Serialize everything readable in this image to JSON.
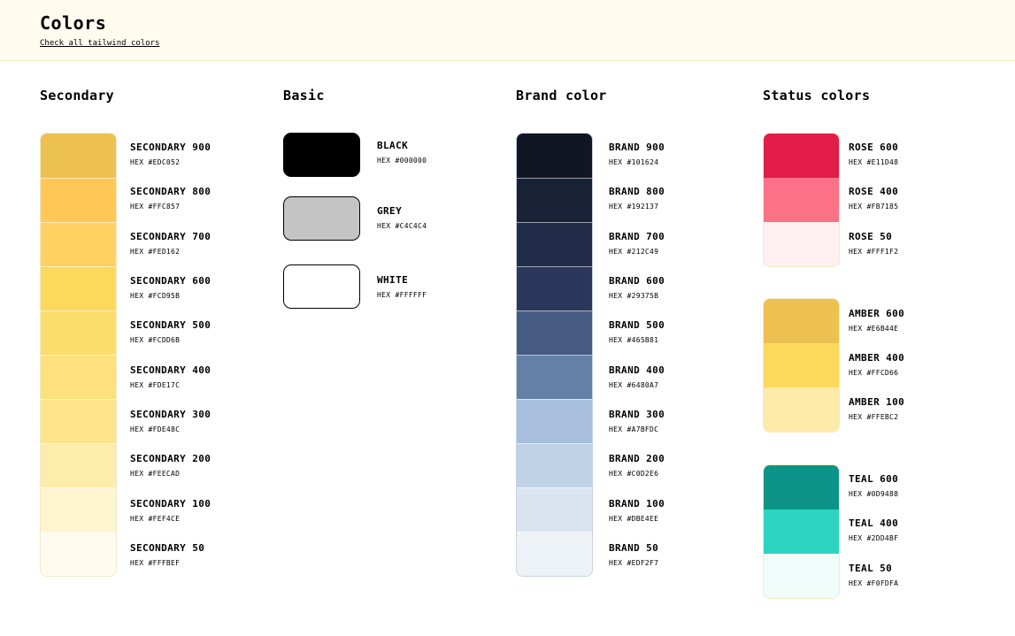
{
  "header": {
    "title": "Colors",
    "link_label": "Check all tailwind colors"
  },
  "secondary": {
    "title": "Secondary",
    "swatches": [
      {
        "name": "SECONDARY 900",
        "hex_label": "HEX #EDC052",
        "color": "#EDC052"
      },
      {
        "name": "SECONDARY 800",
        "hex_label": "HEX #FFC857",
        "color": "#FFC857"
      },
      {
        "name": "SECONDARY 700",
        "hex_label": "HEX #FED162",
        "color": "#FED162"
      },
      {
        "name": "SECONDARY 600",
        "hex_label": "HEX #FCD95B",
        "color": "#FCD95B"
      },
      {
        "name": "SECONDARY 500",
        "hex_label": "HEX #FCDD6B",
        "color": "#FCDD6B"
      },
      {
        "name": "SECONDARY 400",
        "hex_label": "HEX #FDE17C",
        "color": "#FDE17C"
      },
      {
        "name": "SECONDARY 300",
        "hex_label": "HEX #FDE48C",
        "color": "#FDE48C"
      },
      {
        "name": "SECONDARY 200",
        "hex_label": "HEX #FEECAD",
        "color": "#FEECAD"
      },
      {
        "name": "SECONDARY 100",
        "hex_label": "HEX #FEF4CE",
        "color": "#FEF4CE"
      },
      {
        "name": "SECONDARY 50",
        "hex_label": "HEX #FFFBEF",
        "color": "#FFFBEF"
      }
    ]
  },
  "basic": {
    "title": "Basic",
    "swatches": [
      {
        "name": "BLACK",
        "hex_label": "HEX #000000",
        "color": "#000000"
      },
      {
        "name": "GREY",
        "hex_label": "HEX #C4C4C4",
        "color": "#C4C4C4"
      },
      {
        "name": "WHITE",
        "hex_label": "HEX #FFFFFF",
        "color": "#FFFFFF"
      }
    ]
  },
  "brand": {
    "title": "Brand color",
    "swatches": [
      {
        "name": "BRAND 900",
        "hex_label": "HEX #101624",
        "color": "#101624"
      },
      {
        "name": "BRAND 800",
        "hex_label": "HEX #192137",
        "color": "#192137"
      },
      {
        "name": "BRAND 700",
        "hex_label": "HEX #212C49",
        "color": "#212C49"
      },
      {
        "name": "BRAND 600",
        "hex_label": "HEX #29375B",
        "color": "#29375B"
      },
      {
        "name": "BRAND 500",
        "hex_label": "HEX #465B81",
        "color": "#465B81"
      },
      {
        "name": "BRAND 400",
        "hex_label": "HEX #6480A7",
        "color": "#6480A7"
      },
      {
        "name": "BRAND 300",
        "hex_label": "HEX #A7BFDC",
        "color": "#A7BFDC"
      },
      {
        "name": "BRAND 200",
        "hex_label": "HEX #C0D2E6",
        "color": "#C0D2E6"
      },
      {
        "name": "BRAND 100",
        "hex_label": "HEX #DBE4EE",
        "color": "#DBE4EE"
      },
      {
        "name": "BRAND 50",
        "hex_label": "HEX #EDF2F7",
        "color": "#EDF2F7"
      }
    ]
  },
  "status": {
    "title": "Status colors",
    "groups": [
      {
        "swatches": [
          {
            "name": "ROSE 600",
            "hex_label": "HEX #E11D48",
            "color": "#E11D48"
          },
          {
            "name": "ROSE 400",
            "hex_label": "HEX #FB7185",
            "color": "#FB7185"
          },
          {
            "name": "ROSE 50",
            "hex_label": "HEX #FFF1F2",
            "color": "#FFF1F2"
          }
        ]
      },
      {
        "swatches": [
          {
            "name": "AMBER 600",
            "hex_label": "HEX #E6B44E",
            "color": "#E6B44E"
          },
          {
            "name": "AMBER 400",
            "hex_label": "HEX #FFCD66",
            "color": "#FFCD66"
          },
          {
            "name": "AMBER 100",
            "hex_label": "HEX #FFEBC2",
            "color": "#FFEBC2"
          }
        ]
      },
      {
        "swatches": [
          {
            "name": "TEAL 600",
            "hex_label": "HEX #0D9488",
            "color": "#0D9488"
          },
          {
            "name": "TEAL 400",
            "hex_label": "HEX #2DD4BF",
            "color": "#2DD4BF"
          },
          {
            "name": "TEAL 50",
            "hex_label": "HEX #F0FDFA",
            "color": "#F0FDFA"
          }
        ]
      }
    ]
  }
}
